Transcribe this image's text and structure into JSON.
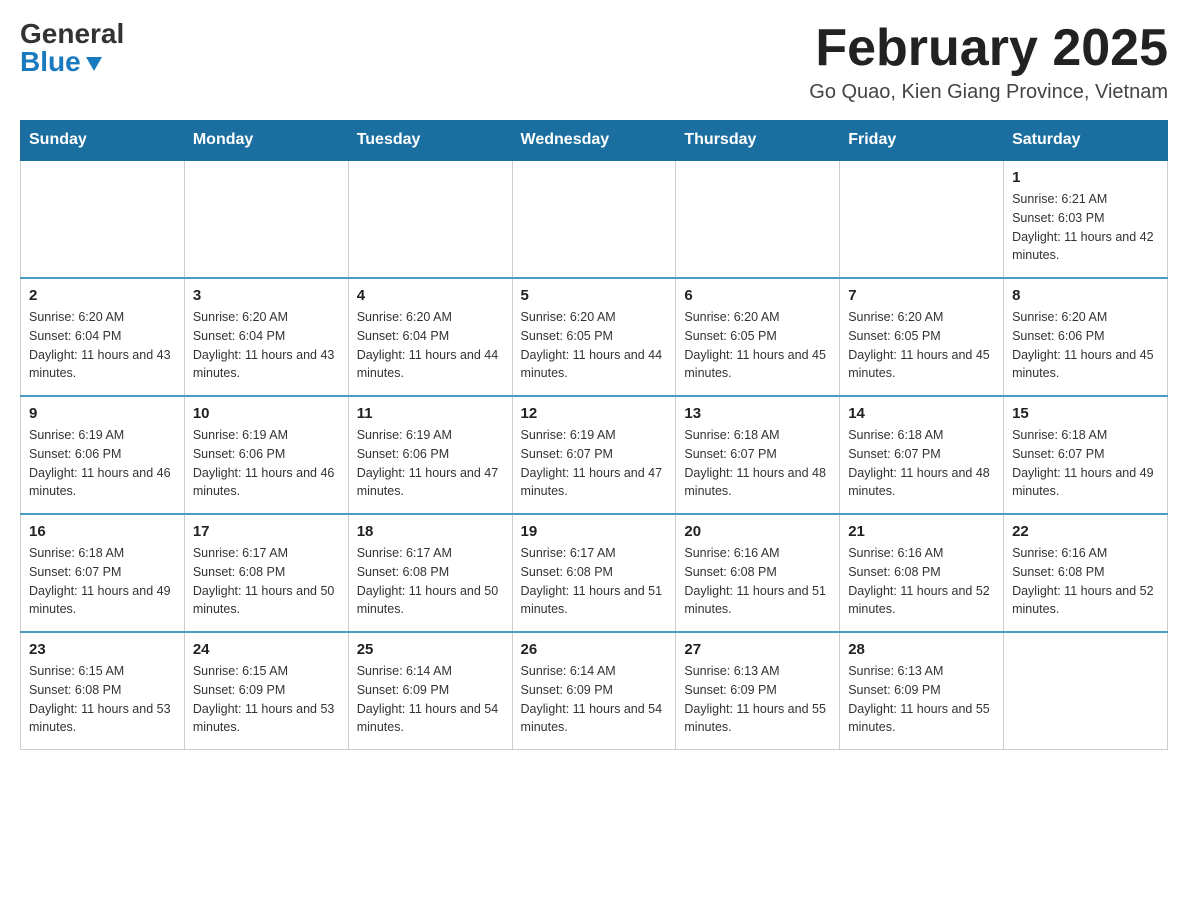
{
  "header": {
    "logo_general": "General",
    "logo_blue": "Blue",
    "month_title": "February 2025",
    "location": "Go Quao, Kien Giang Province, Vietnam"
  },
  "calendar": {
    "days_of_week": [
      "Sunday",
      "Monday",
      "Tuesday",
      "Wednesday",
      "Thursday",
      "Friday",
      "Saturday"
    ],
    "weeks": [
      [
        {
          "day": "",
          "info": ""
        },
        {
          "day": "",
          "info": ""
        },
        {
          "day": "",
          "info": ""
        },
        {
          "day": "",
          "info": ""
        },
        {
          "day": "",
          "info": ""
        },
        {
          "day": "",
          "info": ""
        },
        {
          "day": "1",
          "info": "Sunrise: 6:21 AM\nSunset: 6:03 PM\nDaylight: 11 hours and 42 minutes."
        }
      ],
      [
        {
          "day": "2",
          "info": "Sunrise: 6:20 AM\nSunset: 6:04 PM\nDaylight: 11 hours and 43 minutes."
        },
        {
          "day": "3",
          "info": "Sunrise: 6:20 AM\nSunset: 6:04 PM\nDaylight: 11 hours and 43 minutes."
        },
        {
          "day": "4",
          "info": "Sunrise: 6:20 AM\nSunset: 6:04 PM\nDaylight: 11 hours and 44 minutes."
        },
        {
          "day": "5",
          "info": "Sunrise: 6:20 AM\nSunset: 6:05 PM\nDaylight: 11 hours and 44 minutes."
        },
        {
          "day": "6",
          "info": "Sunrise: 6:20 AM\nSunset: 6:05 PM\nDaylight: 11 hours and 45 minutes."
        },
        {
          "day": "7",
          "info": "Sunrise: 6:20 AM\nSunset: 6:05 PM\nDaylight: 11 hours and 45 minutes."
        },
        {
          "day": "8",
          "info": "Sunrise: 6:20 AM\nSunset: 6:06 PM\nDaylight: 11 hours and 45 minutes."
        }
      ],
      [
        {
          "day": "9",
          "info": "Sunrise: 6:19 AM\nSunset: 6:06 PM\nDaylight: 11 hours and 46 minutes."
        },
        {
          "day": "10",
          "info": "Sunrise: 6:19 AM\nSunset: 6:06 PM\nDaylight: 11 hours and 46 minutes."
        },
        {
          "day": "11",
          "info": "Sunrise: 6:19 AM\nSunset: 6:06 PM\nDaylight: 11 hours and 47 minutes."
        },
        {
          "day": "12",
          "info": "Sunrise: 6:19 AM\nSunset: 6:07 PM\nDaylight: 11 hours and 47 minutes."
        },
        {
          "day": "13",
          "info": "Sunrise: 6:18 AM\nSunset: 6:07 PM\nDaylight: 11 hours and 48 minutes."
        },
        {
          "day": "14",
          "info": "Sunrise: 6:18 AM\nSunset: 6:07 PM\nDaylight: 11 hours and 48 minutes."
        },
        {
          "day": "15",
          "info": "Sunrise: 6:18 AM\nSunset: 6:07 PM\nDaylight: 11 hours and 49 minutes."
        }
      ],
      [
        {
          "day": "16",
          "info": "Sunrise: 6:18 AM\nSunset: 6:07 PM\nDaylight: 11 hours and 49 minutes."
        },
        {
          "day": "17",
          "info": "Sunrise: 6:17 AM\nSunset: 6:08 PM\nDaylight: 11 hours and 50 minutes."
        },
        {
          "day": "18",
          "info": "Sunrise: 6:17 AM\nSunset: 6:08 PM\nDaylight: 11 hours and 50 minutes."
        },
        {
          "day": "19",
          "info": "Sunrise: 6:17 AM\nSunset: 6:08 PM\nDaylight: 11 hours and 51 minutes."
        },
        {
          "day": "20",
          "info": "Sunrise: 6:16 AM\nSunset: 6:08 PM\nDaylight: 11 hours and 51 minutes."
        },
        {
          "day": "21",
          "info": "Sunrise: 6:16 AM\nSunset: 6:08 PM\nDaylight: 11 hours and 52 minutes."
        },
        {
          "day": "22",
          "info": "Sunrise: 6:16 AM\nSunset: 6:08 PM\nDaylight: 11 hours and 52 minutes."
        }
      ],
      [
        {
          "day": "23",
          "info": "Sunrise: 6:15 AM\nSunset: 6:08 PM\nDaylight: 11 hours and 53 minutes."
        },
        {
          "day": "24",
          "info": "Sunrise: 6:15 AM\nSunset: 6:09 PM\nDaylight: 11 hours and 53 minutes."
        },
        {
          "day": "25",
          "info": "Sunrise: 6:14 AM\nSunset: 6:09 PM\nDaylight: 11 hours and 54 minutes."
        },
        {
          "day": "26",
          "info": "Sunrise: 6:14 AM\nSunset: 6:09 PM\nDaylight: 11 hours and 54 minutes."
        },
        {
          "day": "27",
          "info": "Sunrise: 6:13 AM\nSunset: 6:09 PM\nDaylight: 11 hours and 55 minutes."
        },
        {
          "day": "28",
          "info": "Sunrise: 6:13 AM\nSunset: 6:09 PM\nDaylight: 11 hours and 55 minutes."
        },
        {
          "day": "",
          "info": ""
        }
      ]
    ]
  }
}
